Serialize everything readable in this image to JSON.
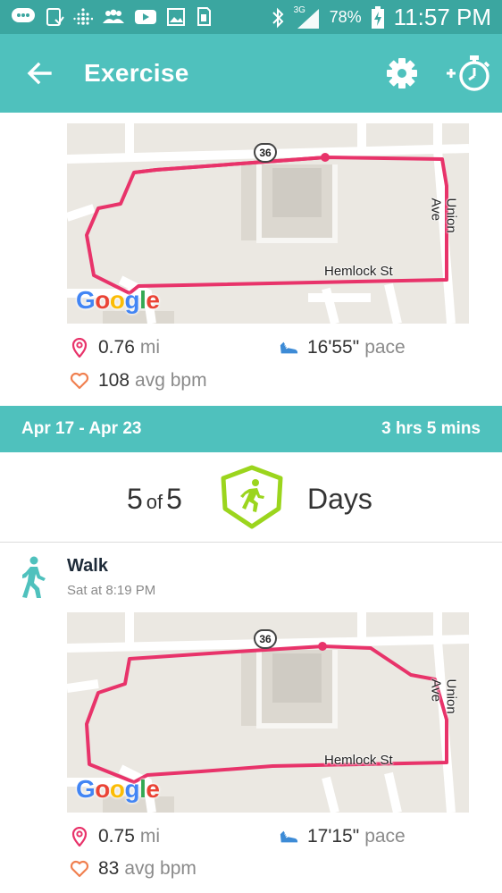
{
  "status_bar": {
    "icons": [
      "message-icon",
      "device-icon",
      "fitbit-icon",
      "people-icon",
      "youtube-icon",
      "gallery-icon",
      "sim-icon",
      "bluetooth-icon",
      "signal-3g-icon",
      "battery-charging-icon"
    ],
    "network": "3G",
    "battery": "78%",
    "time": "11:57 PM"
  },
  "app_bar": {
    "title": "Exercise",
    "back_icon": "arrow-left-icon",
    "settings_icon": "gear-icon",
    "timer_icon": "add-stopwatch-icon"
  },
  "colors": {
    "teal": "#4fc1bd",
    "status_teal": "#3ba6a0",
    "route": "#e8336a",
    "goal_green": "#9bd51d",
    "walk_icon": "#4fc1bd"
  },
  "entries": [
    {
      "map": {
        "route_number": "36",
        "street_right": "Union Ave",
        "street_bottom": "Hemlock St",
        "logo": "Google"
      },
      "distance": {
        "value": "0.76",
        "unit": "mi"
      },
      "pace": {
        "value": "16'55\"",
        "unit": "pace"
      },
      "heart_rate": {
        "value": "108",
        "unit": "avg bpm"
      }
    },
    {
      "activity": "Walk",
      "time": "Sat at 8:19 PM",
      "map": {
        "route_number": "36",
        "street_right": "Union Ave",
        "street_bottom": "Hemlock St",
        "logo": "Google"
      },
      "distance": {
        "value": "0.75",
        "unit": "mi"
      },
      "pace": {
        "value": "17'15\"",
        "unit": "pace"
      },
      "heart_rate": {
        "value": "83",
        "unit": "avg bpm"
      }
    }
  ],
  "week": {
    "range": "Apr 17 - Apr 23",
    "total": "3 hrs 5 mins"
  },
  "goal": {
    "achieved": "5",
    "of": "of",
    "target": "5",
    "label": "Days"
  }
}
